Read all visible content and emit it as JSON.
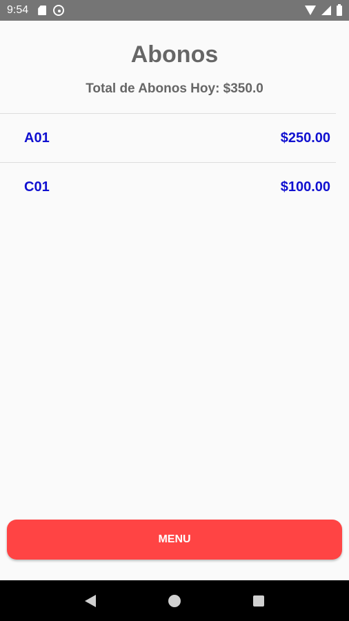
{
  "status_bar": {
    "time": "9:54",
    "icons": [
      "sd-card-icon",
      "do-not-disturb-icon",
      "wifi-icon",
      "signal-icon",
      "battery-icon"
    ]
  },
  "header": {
    "title": "Abonos",
    "subtitle": "Total de Abonos Hoy: $350.0"
  },
  "list": {
    "items": [
      {
        "code": "A01",
        "amount": "$250.00"
      },
      {
        "code": "C01",
        "amount": "$100.00"
      }
    ]
  },
  "footer": {
    "menu_label": "MENU"
  },
  "nav_bar": {
    "icons": [
      "back-icon",
      "home-icon",
      "recents-icon"
    ]
  },
  "colors": {
    "accent": "#ff4444",
    "item_text": "#1010d0",
    "heading_text": "#666666"
  }
}
